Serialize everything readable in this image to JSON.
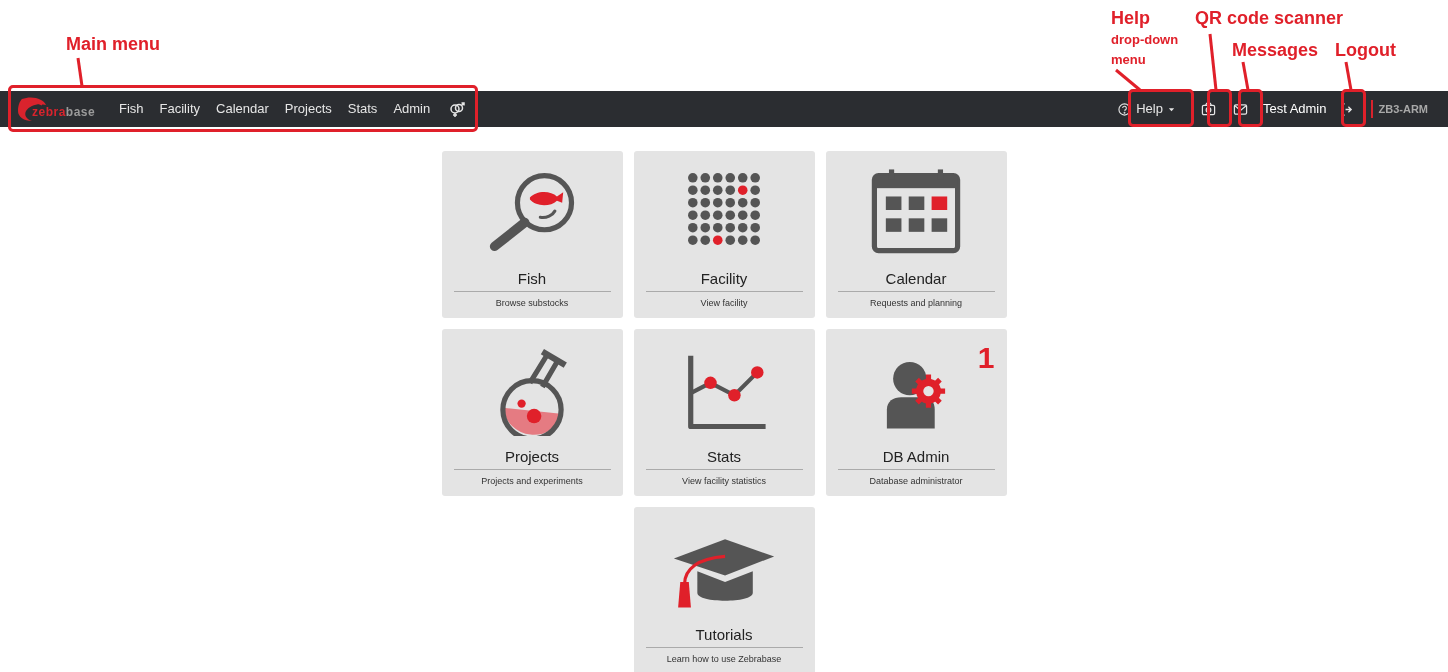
{
  "navbar": {
    "logo": {
      "first": "zebra",
      "second": "base"
    },
    "menu": [
      {
        "label": "Fish"
      },
      {
        "label": "Facility"
      },
      {
        "label": "Calendar"
      },
      {
        "label": "Projects"
      },
      {
        "label": "Stats"
      },
      {
        "label": "Admin"
      }
    ],
    "help": {
      "label": "Help"
    },
    "user": "Test Admin",
    "instance": "ZB3-ARM"
  },
  "cards": [
    {
      "title": "Fish",
      "subtitle": "Browse substocks"
    },
    {
      "title": "Facility",
      "subtitle": "View facility"
    },
    {
      "title": "Calendar",
      "subtitle": "Requests and planning"
    },
    {
      "title": "Projects",
      "subtitle": "Projects and experiments"
    },
    {
      "title": "Stats",
      "subtitle": "View facility statistics"
    },
    {
      "title": "DB Admin",
      "subtitle": "Database administrator",
      "badge": "1"
    },
    {
      "title": "Tutorials",
      "subtitle": "Learn how to use Zebrabase"
    }
  ],
  "annotations": [
    {
      "label": "Main menu"
    },
    {
      "label": "Help",
      "note": "drop-down menu"
    },
    {
      "label": "QR code scanner"
    },
    {
      "label": "Messages"
    },
    {
      "label": "Logout"
    }
  ]
}
